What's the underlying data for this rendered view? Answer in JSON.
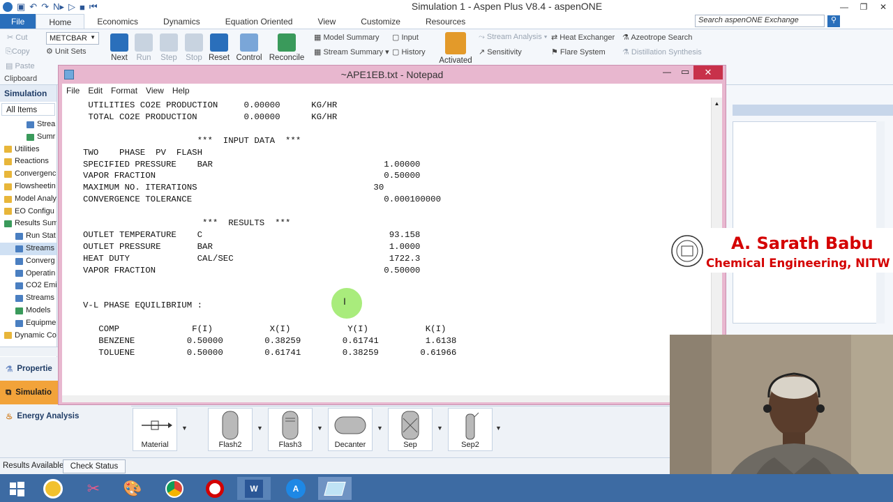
{
  "app": {
    "window_title": "Simulation 1 - Aspen Plus V8.4 - aspenONE",
    "search_placeholder": "Search aspenONE Exchange"
  },
  "ribbon_tabs": [
    "File",
    "Home",
    "Economics",
    "Dynamics",
    "Equation Oriented",
    "View",
    "Customize",
    "Resources"
  ],
  "ribbon": {
    "clipboard": {
      "cut": "Cut",
      "copy": "Copy",
      "paste": "Paste",
      "group": "Clipboard"
    },
    "units": {
      "set": "METCBAR",
      "unit_sets": "Unit Sets"
    },
    "run": [
      "Next",
      "Run",
      "Step",
      "Stop",
      "Reset",
      "Control",
      "Reconcile"
    ],
    "summary": {
      "model_summary": "Model Summary",
      "input": "Input",
      "stream_summary": "Stream Summary",
      "history": "History"
    },
    "activated": "Activated",
    "analysis": {
      "stream_analysis": "Stream Analysis",
      "sensitivity": "Sensitivity",
      "heat_exchanger": "Heat Exchanger",
      "flare_system": "Flare System",
      "azeotrope_search": "Azeotrope Search",
      "distillation_synthesis": "Distillation Synthesis"
    }
  },
  "nav": {
    "header": "Simulation",
    "filter": "All Items",
    "tree": [
      "Strea",
      "Sumr",
      "Utilities",
      "Reactions",
      "Convergenc",
      "Flowsheetin",
      "Model Analy",
      "EO Configu",
      "Results Sum",
      "Run Stat",
      "Streams",
      "Converg",
      "Operatin",
      "CO2 Emi",
      "Streams",
      "Models",
      "Equipme",
      "Dynamic Co"
    ],
    "bottom": [
      "Propertie",
      "Simulatio",
      "Energy Analysis"
    ]
  },
  "notepad": {
    "title": "~APE1EB.txt - Notepad",
    "menu": [
      "File",
      "Edit",
      "Format",
      "View",
      "Help"
    ],
    "lines": [
      " UTILITIES CO2E PRODUCTION     0.00000      KG/HR",
      " TOTAL CO2E PRODUCTION         0.00000      KG/HR",
      "",
      "                      ***  INPUT DATA  ***",
      "TWO    PHASE  PV  FLASH",
      "SPECIFIED PRESSURE    BAR                                 1.00000",
      "VAPOR FRACTION                                            0.50000",
      "MAXIMUM NO. ITERATIONS                                  30",
      "CONVERGENCE TOLERANCE                                     0.000100000",
      "",
      "                       ***  RESULTS  ***",
      "OUTLET TEMPERATURE    C                                    93.158",
      "OUTLET PRESSURE       BAR                                  1.0000",
      "HEAT DUTY             CAL/SEC                              1722.3",
      "VAPOR FRACTION                                            0.50000",
      "",
      "",
      "V-L PHASE EQUILIBRIUM :",
      "",
      "   COMP              F(I)           X(I)           Y(I)           K(I)",
      "   BENZENE          0.50000        0.38259        0.61741         1.6138",
      "   TOLUENE          0.50000        0.61741        0.38259        0.61966"
    ]
  },
  "palette": [
    "Material",
    "Flash2",
    "Flash3",
    "Decanter",
    "Sep",
    "Sep2"
  ],
  "status": {
    "text": "Results Available",
    "button": "Check Status"
  },
  "author": {
    "name": "A. Sarath Babu",
    "dept": "Chemical Engineering, NITW"
  },
  "colors": {
    "file_tab": "#2a6fbb",
    "notepad_frame": "#e8b7cf",
    "taskbar": "#3d6ba3",
    "author_name": "#d40000"
  }
}
